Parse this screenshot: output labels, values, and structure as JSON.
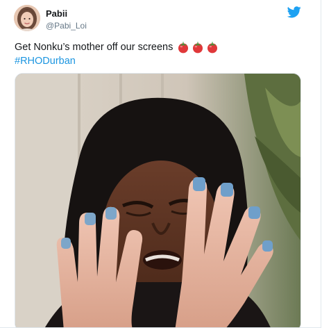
{
  "tweet": {
    "display_name": "Pabii",
    "handle": "@Pabi_Loi",
    "text": "Get Nonku’s mother off our screens",
    "hashtag": "#RHODurban",
    "emojis": [
      "tomato-emoji",
      "tomato-emoji",
      "tomato-emoji"
    ],
    "media": "photo of a woman crying with hands raised"
  },
  "colors": {
    "twitter_blue": "#1da1f2",
    "link": "#1b95e0",
    "text": "#14171a",
    "secondary": "#657786"
  }
}
